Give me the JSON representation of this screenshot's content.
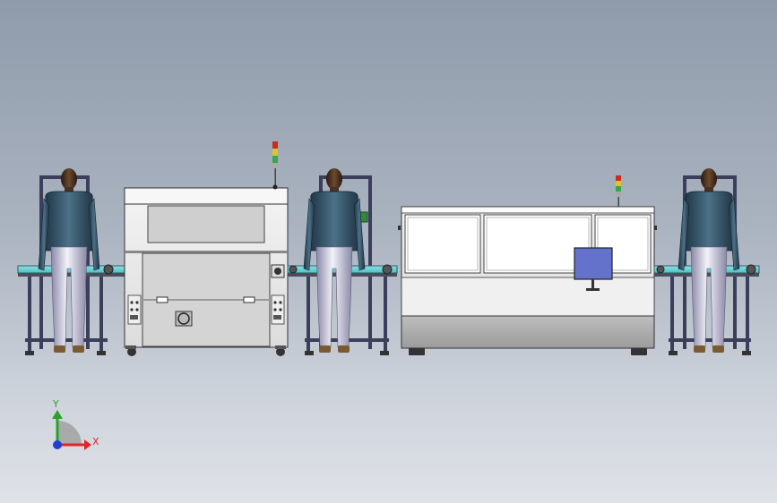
{
  "triad": {
    "x_label": "X",
    "y_label": "Y",
    "x_color": "#e0262a",
    "y_color": "#2ca02c",
    "z_color": "#1f3fd6"
  },
  "colors": {
    "conveyor_belt": "#66d4d6",
    "beacon_red": "#cc2b22",
    "beacon_yellow": "#d9c531",
    "beacon_green": "#3aa64a",
    "monitor_screen": "#6572cc",
    "jacket": "#2f4b5e",
    "pants": "#c9c7da"
  }
}
